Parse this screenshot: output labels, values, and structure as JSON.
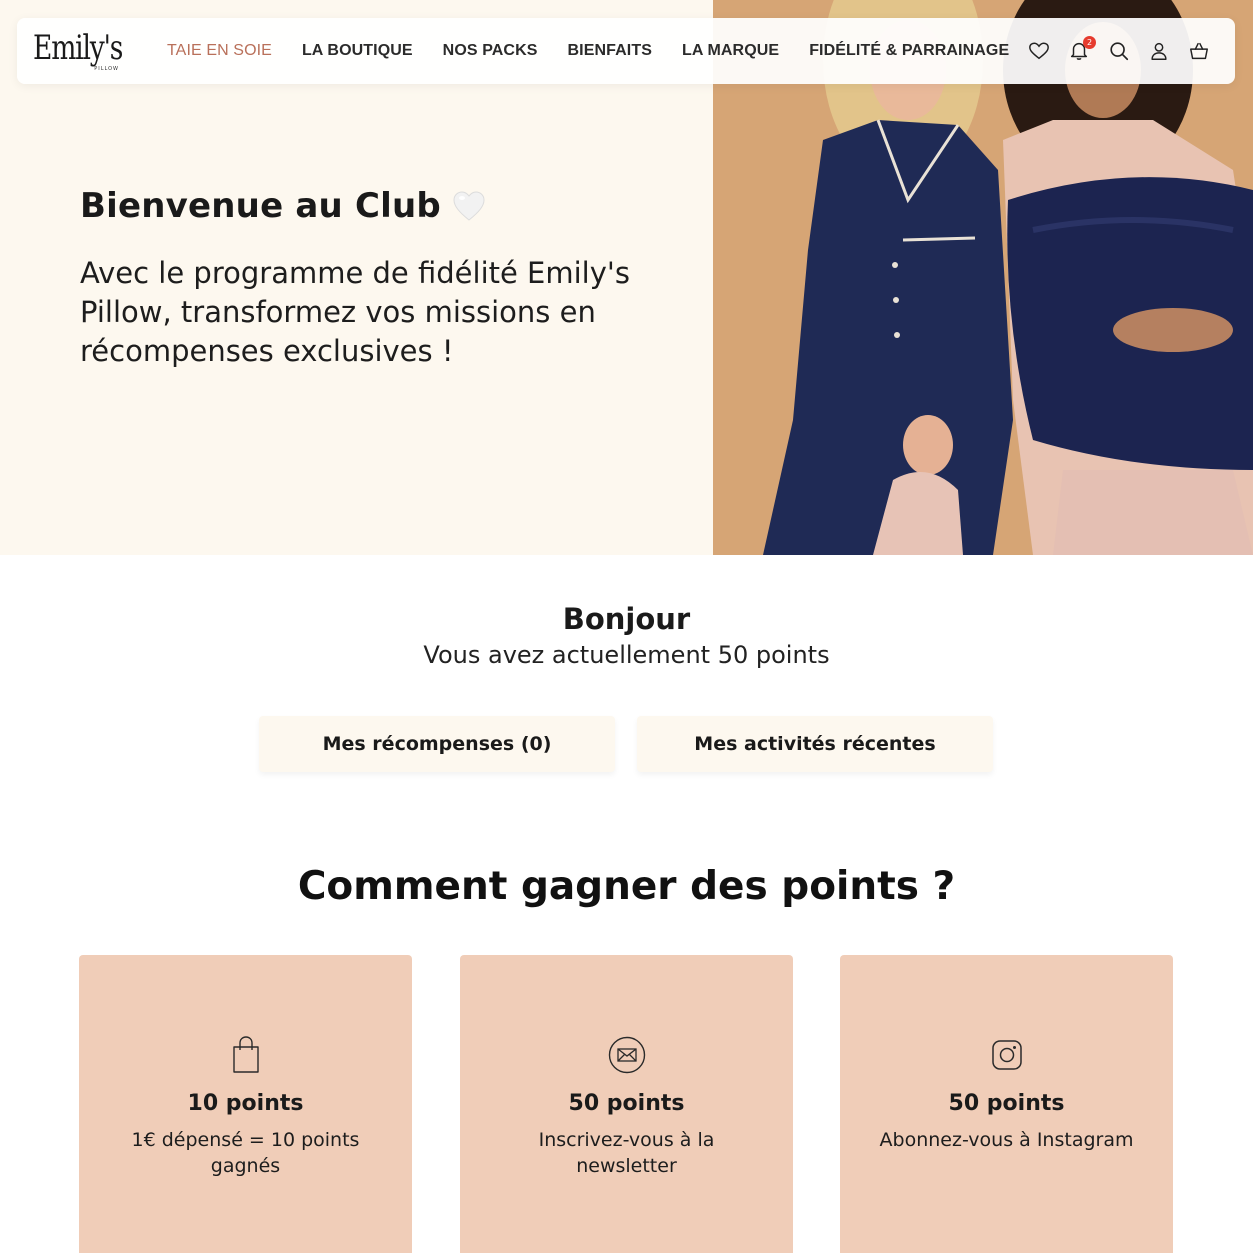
{
  "brand": {
    "logo": "Emily's",
    "logo_sub": "PILLOW"
  },
  "nav": {
    "items": [
      {
        "label": "TAIE EN SOIE",
        "active": true
      },
      {
        "label": "LA BOUTIQUE"
      },
      {
        "label": "NOS PACKS"
      },
      {
        "label": "BIENFAITS"
      },
      {
        "label": "LA MARQUE"
      },
      {
        "label": "FIDÉLITÉ & PARRAINAGE"
      }
    ],
    "icons": [
      "heart-icon",
      "bell-icon",
      "search-icon",
      "user-icon",
      "basket-icon"
    ],
    "notification_count": "2",
    "active_color": "#b9705a"
  },
  "hero": {
    "title": "Bienvenue au Club",
    "text": "Avec le programme de fidélité Emily's Pillow, transformez vos missions en récompenses exclusives !"
  },
  "greeting": {
    "title": "Bonjour",
    "points_text": "Vous avez actuellement 50 points"
  },
  "tabs": {
    "rewards": "Mes récompenses (0)",
    "activity": "Mes activités récentes"
  },
  "earn": {
    "title": "Comment gagner des points ?",
    "cards": [
      {
        "icon": "shopping-bag-icon",
        "points": "10 points",
        "desc": "1€ dépensé = 10 points gagnés"
      },
      {
        "icon": "envelope-icon",
        "points": "50 points",
        "desc": "Inscrivez-vous à la newsletter"
      },
      {
        "icon": "instagram-icon",
        "points": "50 points",
        "desc": "Abonnez-vous à Instagram"
      }
    ]
  },
  "colors": {
    "hero_bg": "#fdf8ef",
    "card_bg": "#f0cdb8",
    "photo_bg": "#d9a877",
    "badge": "#e63b2e"
  }
}
